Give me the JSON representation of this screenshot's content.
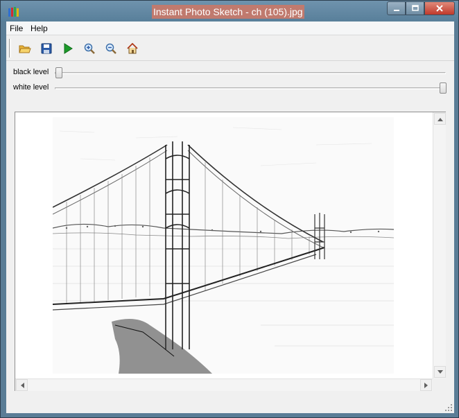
{
  "window": {
    "title": "Instant Photo Sketch - ch (105).jpg"
  },
  "menu": {
    "file": "File",
    "help": "Help"
  },
  "toolbar": {
    "icons": [
      "open-folder-icon",
      "save-disk-icon",
      "play-icon",
      "zoom-in-icon",
      "zoom-out-icon",
      "home-icon"
    ]
  },
  "sliders": {
    "black_label": "black level",
    "black_value": 0,
    "white_label": "white level",
    "white_value": 1
  },
  "colors": {
    "title_highlight": "#c07a6e",
    "close_button": "#c0392b",
    "play_green": "#1c9a2a"
  }
}
